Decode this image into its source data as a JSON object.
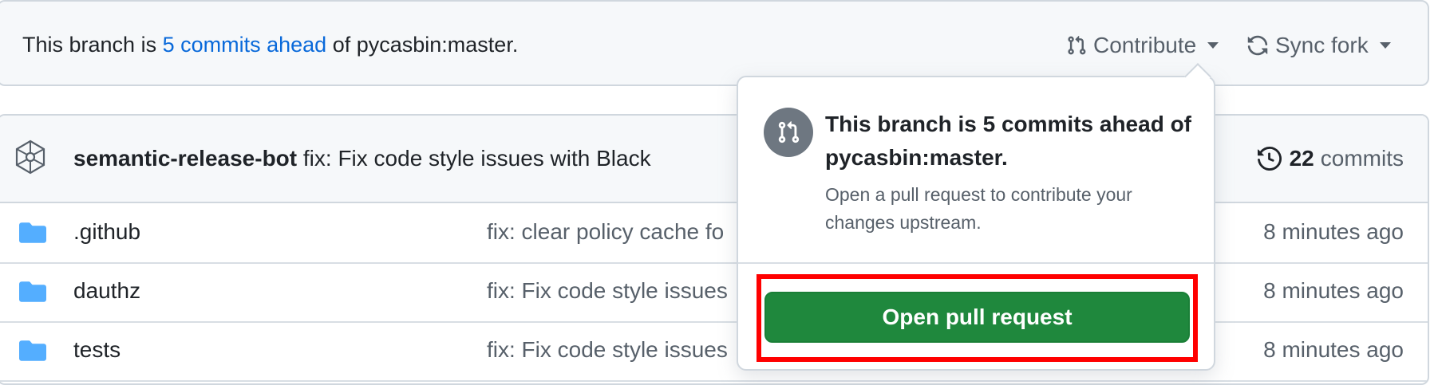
{
  "banner": {
    "prefix": "This branch is",
    "link_text": "5 commits ahead",
    "suffix": "of pycasbin:master.",
    "contribute_label": "Contribute",
    "sync_label": "Sync fork"
  },
  "commit_bar": {
    "author": "semantic-release-bot",
    "message": "fix: Fix code style issues with Black",
    "truncated_hash_tail": "o",
    "commit_count": "22",
    "commit_word": "commits"
  },
  "files": [
    {
      "name": ".github",
      "message": "fix: clear policy cache fo",
      "time": "8 minutes ago"
    },
    {
      "name": "dauthz",
      "message": "fix: Fix code style issues",
      "time": "8 minutes ago"
    },
    {
      "name": "tests",
      "message": "fix: Fix code style issues",
      "time": "8 minutes ago"
    }
  ],
  "popover": {
    "title": "This branch is 5 commits ahead of pycasbin:master.",
    "description": "Open a pull request to contribute your changes upstream.",
    "button_label": "Open pull request"
  },
  "colors": {
    "link": "#0969da",
    "button_green": "#1f883d",
    "highlight_red": "#ff0000",
    "folder_blue": "#54aeff"
  },
  "icons": {
    "contribute": "git-pull-request-icon",
    "sync": "sync-icon",
    "avatar": "bot-avatar-icon",
    "history": "history-icon",
    "folder": "folder-icon"
  }
}
